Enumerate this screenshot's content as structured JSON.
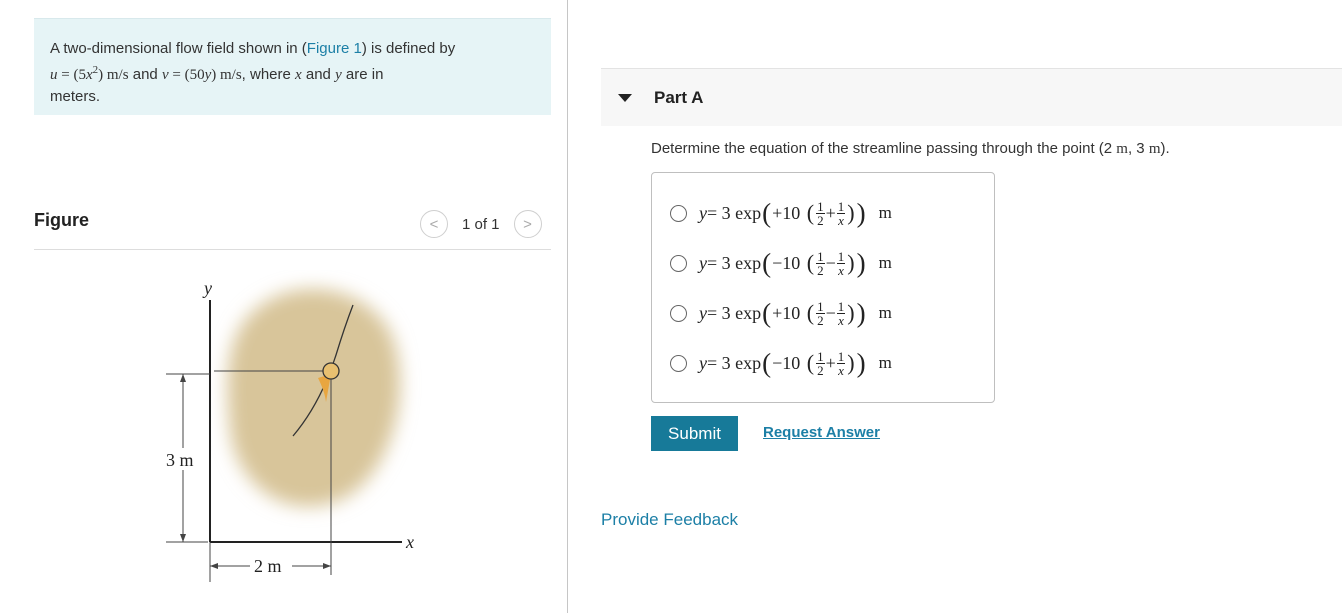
{
  "intro": {
    "text_prefix": "A two-dimensional flow field shown in (",
    "figure_link": "Figure 1",
    "text_mid": ") is defined by",
    "u_eq": "u = (5x",
    "u_exp": "2",
    "u_close": ") m/s",
    "and1": " and ",
    "v_eq": "v = (50y) m/s",
    "where": ", where ",
    "x": "x",
    "and2": " and ",
    "y": "y",
    "are_in": " are in",
    "meters": "meters."
  },
  "figure": {
    "title": "Figure",
    "pager": "1 of 1",
    "prev_icon": "<",
    "next_icon": ">",
    "labels": {
      "y_axis": "y",
      "x_axis": "x",
      "height": "3 m",
      "width": "2 m"
    }
  },
  "partA": {
    "title": "Part A",
    "question_prefix": "Determine the equation of the streamline passing through the point (2 ",
    "m1": "m",
    "comma": ", 3 ",
    "m2": "m",
    "close": ").",
    "choices": [
      {
        "sign": "+10",
        "op": "+"
      },
      {
        "sign": "−10",
        "op": "−"
      },
      {
        "sign": "+10",
        "op": "−"
      },
      {
        "sign": "−10",
        "op": "+"
      }
    ],
    "expr": {
      "y": "y",
      "eq": " = 3 exp ",
      "half_num": "1",
      "half_den": "2",
      "inv_num": "1",
      "inv_den": "x",
      "unit": "m"
    },
    "submit_label": "Submit",
    "request_label": "Request Answer"
  },
  "feedback_label": "Provide Feedback",
  "colors": {
    "accent": "#177a99",
    "link": "#1c7fa6",
    "intro_bg": "#e6f4f6",
    "blob": "#d8c59a"
  }
}
